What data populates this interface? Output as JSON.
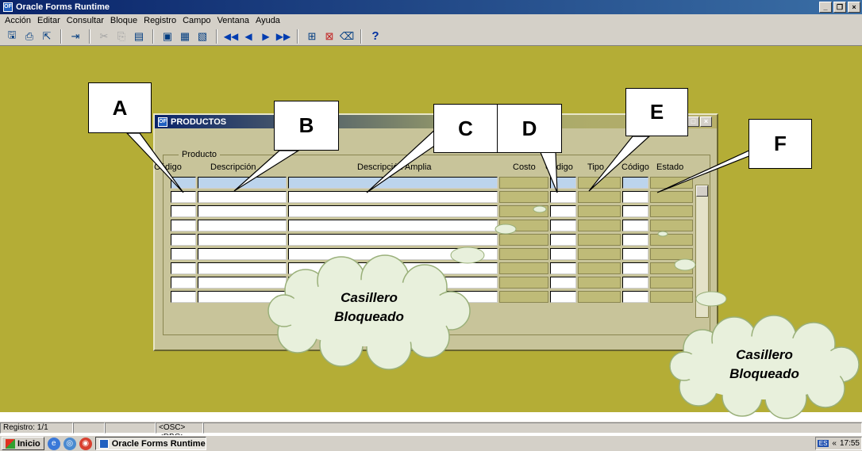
{
  "app": {
    "title": "Oracle Forms Runtime"
  },
  "menu": [
    "Acción",
    "Editar",
    "Consultar",
    "Bloque",
    "Registro",
    "Campo",
    "Ventana",
    "Ayuda"
  ],
  "toolbar_icons": [
    "save-icon",
    "print-icon",
    "exit-icon",
    "enter-query-icon",
    "cut-icon",
    "copy-icon",
    "paste-icon",
    "insert-record-icon",
    "duplicate-record-icon",
    "delete-record-icon",
    "first-record-icon",
    "previous-record-icon",
    "next-record-icon",
    "last-record-icon",
    "create-record-icon",
    "remove-record-icon",
    "clear-icon",
    "help-icon"
  ],
  "toolbar_help": "?",
  "form": {
    "title": "PRODUCTOS",
    "group_label": "Producto",
    "columns": [
      "Código",
      "Descripción",
      "Descripción Amplia",
      "Costo",
      "Código",
      "Tipo",
      "Código",
      "Estado"
    ],
    "row_count": 9,
    "locked_columns": [
      "Costo",
      "Tipo",
      "Estado"
    ]
  },
  "annotations": {
    "labels": [
      "A",
      "B",
      "C",
      "D",
      "E",
      "F"
    ],
    "cloud_text": [
      "Casillero",
      "Bloqueado"
    ]
  },
  "status": {
    "record": "Registro: 1/1",
    "flags": "<OSC> <DBG>"
  },
  "taskbar": {
    "start": "Inicio",
    "task": "Oracle Forms Runtime",
    "lang": "ES",
    "clock": "17:55"
  },
  "colors": {
    "workspace": "#b4ad36",
    "form_bg": "#c8c49a",
    "selected_row": "#bcd4ec",
    "locked_cell": "#bfbb78",
    "cloud_fill": "#e8f0dc",
    "cloud_stroke": "#9ab07a"
  }
}
